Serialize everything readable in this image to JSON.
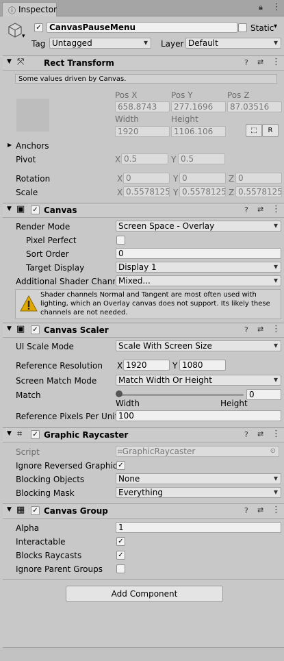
{
  "window": {
    "tab_title": "Inspector",
    "icons": [
      "info-icon",
      "lock-icon",
      "menu-icon"
    ]
  },
  "object": {
    "name": "CanvasPauseMenu",
    "active": true,
    "static_label": "Static",
    "static_checked": false,
    "tag_label": "Tag",
    "tag_value": "Untagged",
    "layer_label": "Layer",
    "layer_value": "Default"
  },
  "rect_transform": {
    "title": "Rect Transform",
    "note": "Some values driven by Canvas.",
    "pos_x_label": "Pos X",
    "pos_y_label": "Pos Y",
    "pos_z_label": "Pos Z",
    "pos_x": "658.8743",
    "pos_y": "277.1696",
    "pos_z": "87.03516",
    "width_label": "Width",
    "height_label": "Height",
    "width": "1920",
    "height": "1106.106",
    "raw_button": "R",
    "anchors_label": "Anchors",
    "pivot_label": "Pivot",
    "pivot_x": "0.5",
    "pivot_y": "0.5",
    "rotation_label": "Rotation",
    "rot_x": "0",
    "rot_y": "0",
    "rot_z": "0",
    "scale_label": "Scale",
    "scale_x": "0.5578125",
    "scale_y": "0.5578125",
    "scale_z": "0.5578125",
    "x": "X",
    "y": "Y",
    "z": "Z"
  },
  "canvas": {
    "title": "Canvas",
    "render_mode_label": "Render Mode",
    "render_mode": "Screen Space - Overlay",
    "pixel_perfect_label": "Pixel Perfect",
    "sort_order_label": "Sort Order",
    "sort_order": "0",
    "target_display_label": "Target Display",
    "target_display": "Display 1",
    "shader_channels_label": "Additional Shader Channe",
    "shader_channels": "Mixed...",
    "warning_text": "Shader channels Normal and Tangent are most often used with lighting, which an Overlay canvas does not support. Its likely these channels are not needed."
  },
  "canvas_scaler": {
    "title": "Canvas Scaler",
    "ui_scale_mode_label": "UI Scale Mode",
    "ui_scale_mode": "Scale With Screen Size",
    "ref_res_label": "Reference Resolution",
    "ref_x": "1920",
    "ref_y": "1080",
    "screen_match_label": "Screen Match Mode",
    "screen_match": "Match Width Or Height",
    "match_label": "Match",
    "match_value": "0",
    "match_width_label": "Width",
    "match_height_label": "Height",
    "ref_ppu_label": "Reference Pixels Per Unit",
    "ref_ppu": "100"
  },
  "graphic_raycaster": {
    "title": "Graphic Raycaster",
    "script_label": "Script",
    "script_value": "GraphicRaycaster",
    "ignore_reversed_label": "Ignore Reversed Graphics",
    "blocking_objects_label": "Blocking Objects",
    "blocking_objects": "None",
    "blocking_mask_label": "Blocking Mask",
    "blocking_mask": "Everything"
  },
  "canvas_group": {
    "title": "Canvas Group",
    "alpha_label": "Alpha",
    "alpha": "1",
    "interactable_label": "Interactable",
    "blocks_raycasts_label": "Blocks Raycasts",
    "ignore_parent_label": "Ignore Parent Groups"
  },
  "add_component": "Add Component",
  "check_mark": "✓",
  "colors": {
    "panel": "#c8c8c8",
    "header": "#cbcbcb",
    "field": "#f0f0f0",
    "warning": "#e0a800"
  }
}
